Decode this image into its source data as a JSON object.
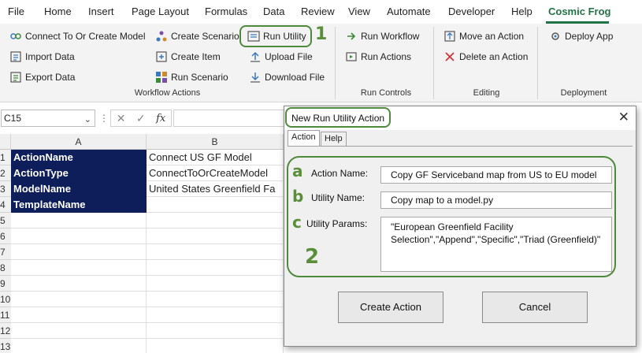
{
  "menu": [
    "File",
    "Home",
    "Insert",
    "Page Layout",
    "Formulas",
    "Data",
    "Review",
    "View",
    "Automate",
    "Developer",
    "Help",
    "Cosmic Frog"
  ],
  "ribbon": {
    "col1": [
      "Connect To Or Create Model",
      "Import Data",
      "Export Data"
    ],
    "col2": [
      "Create Scenario",
      "Create Item",
      "Run Scenario"
    ],
    "col3": [
      "Run Utility",
      "Upload File",
      "Download File"
    ],
    "run_controls": [
      "Run Workflow",
      "Run Actions"
    ],
    "editing": [
      "Move an Action",
      "Delete an Action"
    ],
    "deployment": [
      "Deploy App"
    ],
    "groups": [
      "Workflow Actions",
      "Run Controls",
      "Editing",
      "Deployment"
    ]
  },
  "annotations": {
    "one": "1",
    "two": "2",
    "a": "a",
    "b": "b",
    "c": "c"
  },
  "formula_bar": {
    "namebox": "C15",
    "fx": "fx"
  },
  "sheet": {
    "columns": [
      "A",
      "B"
    ],
    "rows": [
      "1",
      "2",
      "3",
      "4",
      "5",
      "6",
      "7",
      "8",
      "9",
      "10",
      "11",
      "12",
      "13"
    ],
    "cells_a": [
      "ActionName",
      "ActionType",
      "ModelName",
      "TemplateName"
    ],
    "cells_b": [
      "Connect US GF Model",
      "ConnectToOrCreateModel",
      "United States Greenfield Fa",
      ""
    ]
  },
  "dialog": {
    "title": "New Run Utility Action",
    "tabs": [
      "Action",
      "Help"
    ],
    "action_name_label": "Action Name:",
    "action_name_value": "Copy GF Serviceband map from US to EU model",
    "utility_name_label": "Utility Name:",
    "utility_name_value": "Copy map to a model.py",
    "utility_params_label": "Utility Params:",
    "utility_params_value": "\"European Greenfield Facility Selection\",\"Append\",\"Specific\",\"Triad (Greenfield)\"",
    "create_button": "Create Action",
    "cancel_button": "Cancel"
  },
  "colors": {
    "accent_green": "#217346",
    "annotation_green": "#4f8a3c",
    "header_navy": "#0e1e5b"
  }
}
